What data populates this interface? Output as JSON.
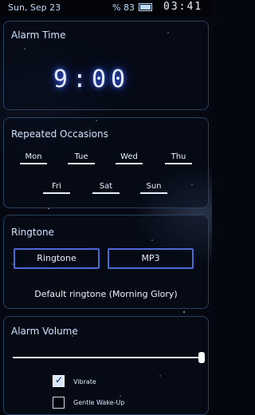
{
  "status": {
    "date": "Sun, Sep 23",
    "battery": "% 83",
    "time": "03:41"
  },
  "alarm_time": {
    "title": "Alarm Time",
    "time": "9:00"
  },
  "occasions": {
    "title": "Repeated Occasions",
    "days": [
      "Mon",
      "Tue",
      "Wed",
      "Thu",
      "Fri",
      "Sat",
      "Sun"
    ]
  },
  "ringtone": {
    "title": "Ringtone",
    "ringtone_button": "Ringtone",
    "mp3_button": "MP3",
    "default_text": "Default ringtone (Morning Glory)"
  },
  "volume": {
    "title": "Alarm Volume",
    "level": 1.0,
    "vibrate_label": "Vibrate",
    "vibrate_checked": true,
    "gentle_label": "Gentle Wake-Up",
    "gentle_checked": false
  },
  "colors": {
    "accent": "#4a6ad8",
    "glow": "#3f6bff",
    "background": "#050810"
  }
}
